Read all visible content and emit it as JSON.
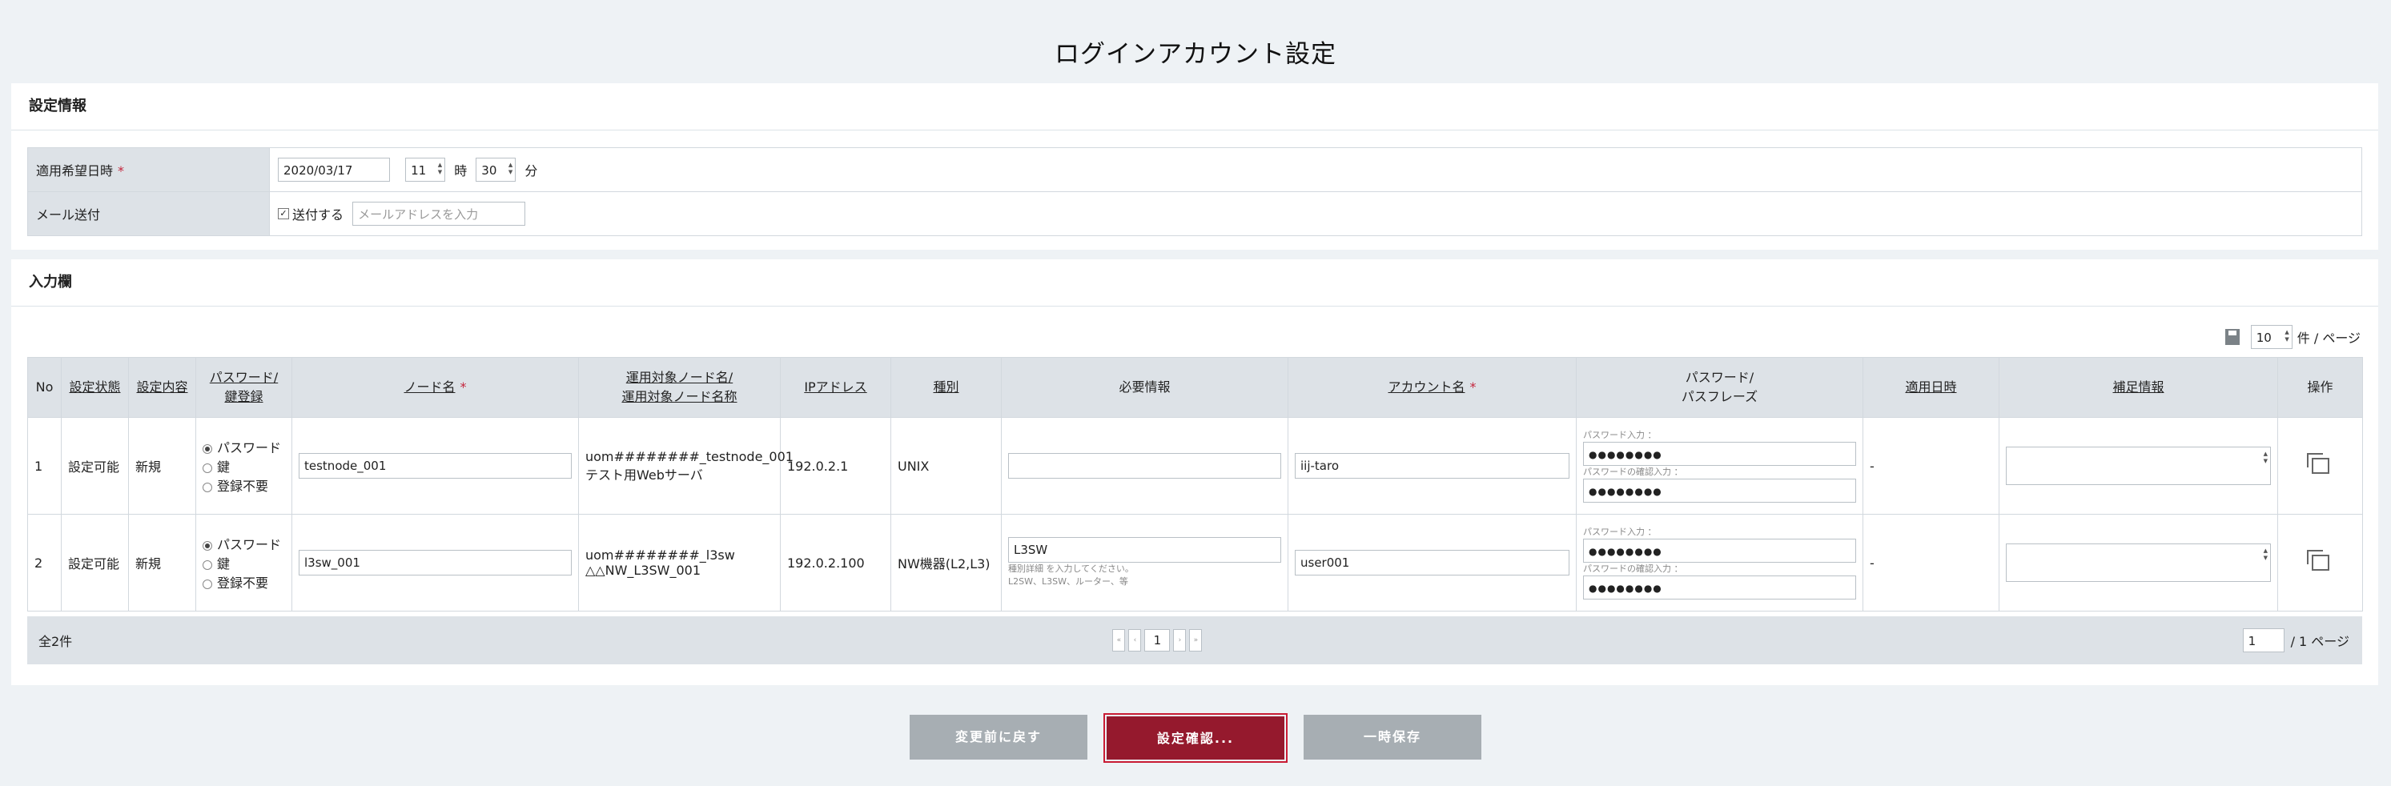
{
  "page": {
    "title": "ログインアカウント設定"
  },
  "settings": {
    "heading": "設定情報",
    "apply_date_label": "適用希望日時",
    "required_mark": "*",
    "date_value": "2020/03/17",
    "hour_value": "11",
    "hour_unit": "時",
    "minute_value": "30",
    "minute_unit": "分",
    "mail_label": "メール送付",
    "mail_checkbox_label": "送付する",
    "mail_checked": true,
    "mail_placeholder": "メールアドレスを入力"
  },
  "input": {
    "heading": "入力欄",
    "per_page_value": "10",
    "per_page_unit": "件 / ページ",
    "columns": {
      "no": "No",
      "status": "設定状態",
      "content": "設定内容",
      "pwkey_1": "パスワード/",
      "pwkey_2": "鍵登録",
      "node": "ノード名",
      "ops_node_1": "運用対象ノード名/",
      "ops_node_2": "運用対象ノード名称",
      "ip": "IPアドレス",
      "type": "種別",
      "required_info": "必要情報",
      "account": "アカウント名",
      "password_1": "パスワード/",
      "password_2": "パスフレーズ",
      "apply_date": "適用日時",
      "note": "補足情報",
      "action": "操作"
    },
    "radio_options": [
      "パスワード",
      "鍵",
      "登録不要"
    ],
    "pw_input_label": "パスワード入力 ：",
    "pw_confirm_label": "パスワードの確認入力 ：",
    "rows": [
      {
        "no": "1",
        "status": "設定可能",
        "content": "新規",
        "node": "testnode_001",
        "ops_node": "uom########_testnode_001",
        "ops_node_name": "テスト用Webサーバ",
        "ip": "192.0.2.1",
        "type": "UNIX",
        "required_info": "",
        "required_hint": "",
        "required_hint2": "",
        "account": "iij-taro",
        "password": "●●●●●●●●",
        "password_confirm": "●●●●●●●●",
        "apply_date": "-"
      },
      {
        "no": "2",
        "status": "設定可能",
        "content": "新規",
        "node": "l3sw_001",
        "ops_node": "uom########_l3sw",
        "ops_node_name": "△△NW_L3SW_001",
        "ip": "192.0.2.100",
        "type": "NW機器(L2,L3)",
        "required_info": "L3SW",
        "required_hint": "種別詳細 を入力してください。",
        "required_hint2": "L2SW、L3SW、ルーター、等",
        "account": "user001",
        "password": "●●●●●●●●",
        "password_confirm": "●●●●●●●●",
        "apply_date": "-"
      }
    ],
    "total": "全2件",
    "current_page": "1",
    "page_input": "1",
    "page_total": "/ 1 ページ"
  },
  "buttons": {
    "revert": "変更前に戻す",
    "confirm": "設定確認...",
    "save": "一時保存"
  },
  "colors": {
    "accent": "#95192d",
    "required": "#c4263d",
    "header_bg": "#dde2e7"
  }
}
